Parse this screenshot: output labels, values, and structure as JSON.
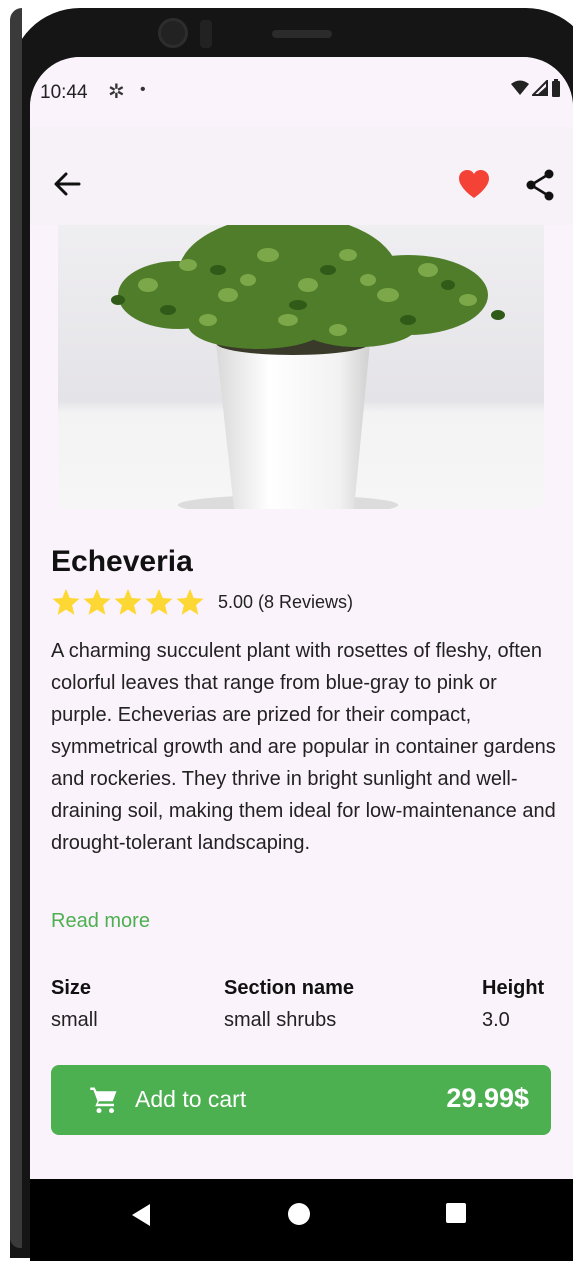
{
  "status_bar": {
    "time": "10:44",
    "settings_icon": "gear-icon",
    "dot": "•"
  },
  "app_bar": {
    "back_icon": "arrow-left-icon",
    "favorite_icon": "heart-icon",
    "favorite_color": "#f44336",
    "share_icon": "share-icon"
  },
  "product": {
    "name": "Echeveria",
    "rating_value": 5,
    "rating_max": 5,
    "rating_text": "5.00 (8 Reviews)",
    "star_color": "#fdd835",
    "description": "A charming succulent plant with rosettes of fleshy, often colorful leaves that range from blue-gray to pink or purple. Echeverias are prized for their compact, symmetrical growth and are popular in container gardens and rockeries. They thrive in bright sunlight and well-draining soil, making them ideal for low-maintenance and drought-tolerant landscaping.",
    "read_more": "Read more"
  },
  "specs": [
    {
      "label": "Size",
      "value": "small"
    },
    {
      "label": "Section name",
      "value": "small shrubs"
    },
    {
      "label": "Height",
      "value": "3.0"
    }
  ],
  "cart": {
    "label": "Add to cart",
    "price": "29.99$",
    "icon": "cart-icon",
    "color": "#4caf50"
  },
  "nav_bar": {
    "back": "nav-back-icon",
    "home": "nav-home-icon",
    "recents": "nav-recents-icon"
  }
}
